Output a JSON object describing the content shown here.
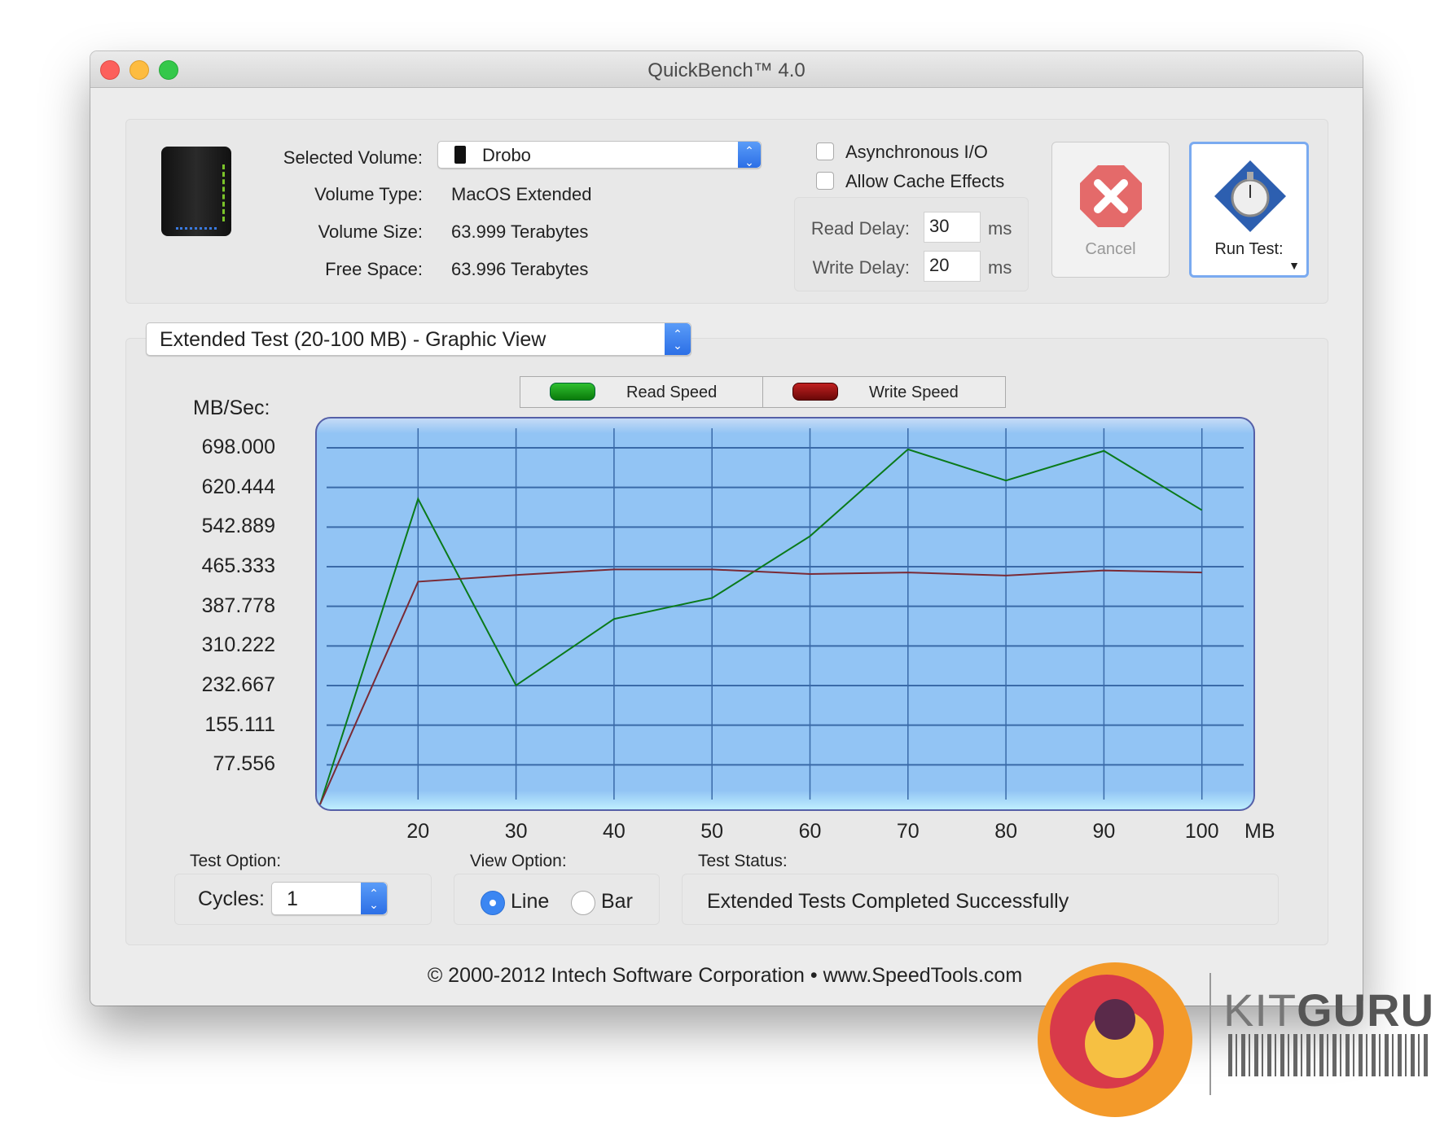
{
  "window": {
    "title": "QuickBench™ 4.0"
  },
  "volume": {
    "selected_label": "Selected Volume:",
    "selected_value": "Drobo",
    "type_label": "Volume Type:",
    "type_value": "MacOS Extended",
    "size_label": "Volume Size:",
    "size_value": "63.999 Terabytes",
    "free_label": "Free Space:",
    "free_value": "63.996 Terabytes"
  },
  "options": {
    "async_label": "Asynchronous I/O",
    "async_checked": false,
    "cache_label": "Allow Cache Effects",
    "cache_checked": false,
    "read_delay_label": "Read Delay:",
    "read_delay_value": "30",
    "write_delay_label": "Write Delay:",
    "write_delay_value": "20",
    "unit": "ms"
  },
  "buttons": {
    "cancel": "Cancel",
    "run": "Run Test:"
  },
  "test_select": "Extended Test (20-100 MB) - Graphic View",
  "legend": {
    "read": "Read Speed",
    "write": "Write Speed",
    "read_color": "#0a8a0a",
    "write_color": "#8a1010"
  },
  "chart_data": {
    "type": "line",
    "ylabel": "MB/Sec:",
    "xlabel": "MB",
    "ylim": [
      0,
      698
    ],
    "yticks": [
      "698.000",
      "620.444",
      "542.889",
      "465.333",
      "387.778",
      "310.222",
      "232.667",
      "155.111",
      "77.556"
    ],
    "xticks": [
      "20",
      "30",
      "40",
      "50",
      "60",
      "70",
      "80",
      "90",
      "100"
    ],
    "grid": true,
    "x": [
      10,
      20,
      30,
      40,
      50,
      60,
      70,
      80,
      90,
      100
    ],
    "series": [
      {
        "name": "Read Speed",
        "color": "#0a7a1a",
        "values": [
          0,
          598,
          233,
          363,
          404,
          525,
          695,
          634,
          692,
          576
        ]
      },
      {
        "name": "Write Speed",
        "color": "#7a2a35",
        "values": [
          0,
          436,
          449,
          460,
          460,
          451,
          454,
          448,
          458,
          454
        ]
      }
    ]
  },
  "bottom": {
    "test_option_label": "Test Option:",
    "cycles_label": "Cycles:",
    "cycles_value": "1",
    "view_option_label": "View Option:",
    "line_label": "Line",
    "bar_label": "Bar",
    "view_selected": "Line",
    "status_label": "Test Status:",
    "status_value": "Extended Tests Completed Successfully"
  },
  "footer": "© 2000-2012 Intech Software Corporation • www.SpeedTools.com",
  "watermark": {
    "text_light": "KIT",
    "text_bold": "GURU"
  }
}
